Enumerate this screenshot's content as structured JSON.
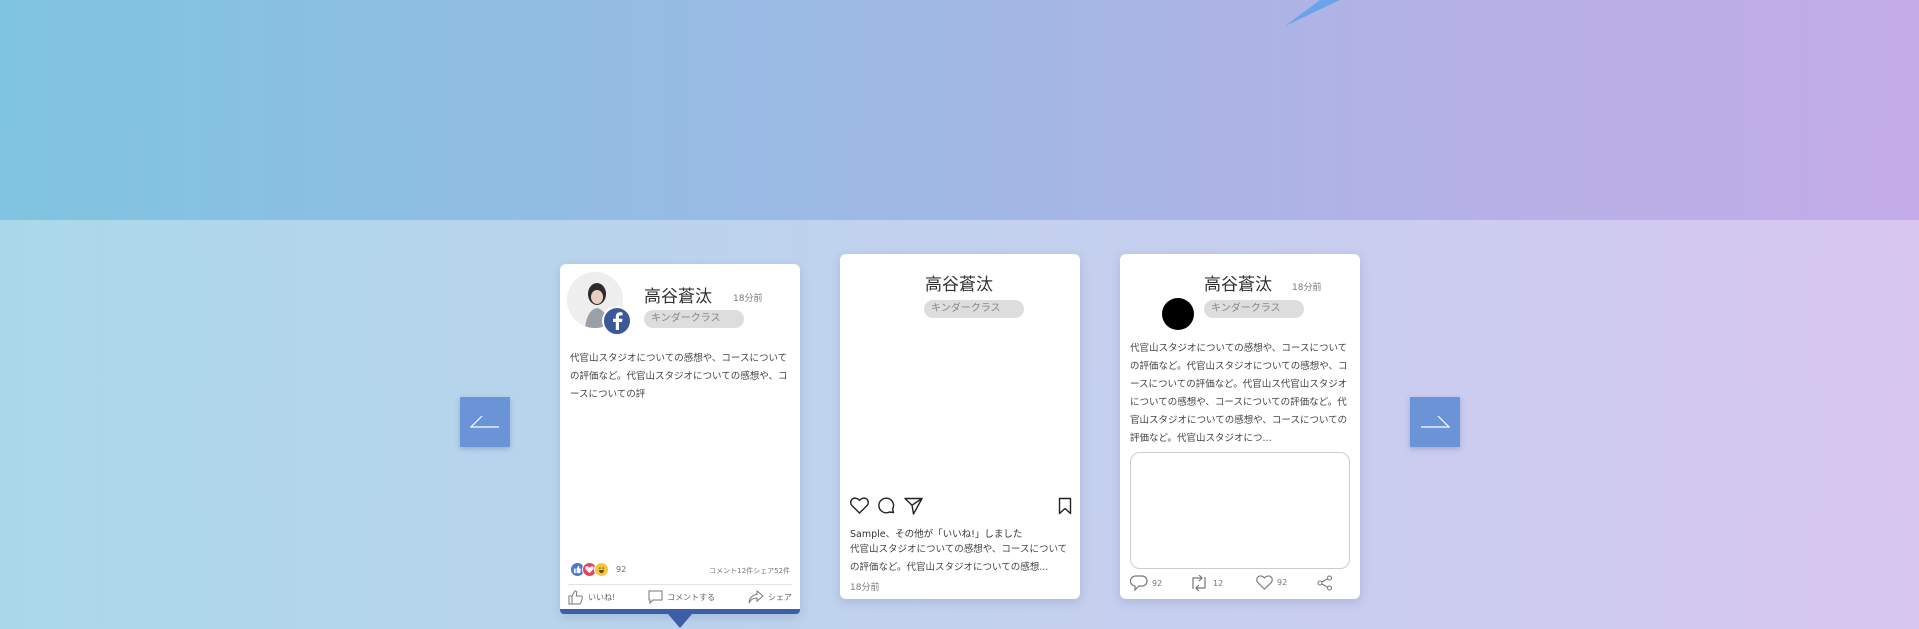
{
  "colors": {
    "facebook_blue": "#3b5998",
    "arrow_button": "#6b93d8",
    "bottom_bar": "#3b5ea8"
  },
  "carousel": {
    "prev_icon": "arrow-left-icon",
    "next_icon": "arrow-right-icon"
  },
  "facebook_card": {
    "name": "高谷蒼汰",
    "time": "18分前",
    "class_tag": "キンダークラス",
    "body": "代官山スタジオについての感想や、コースについての評価など。代官山スタジオについての感想や、コースについての評",
    "reaction_count": "92",
    "stats": "コメント12件シェア52件",
    "actions": {
      "like": "いいね!",
      "comment": "コメントする",
      "share": "シェア"
    }
  },
  "instagram_card": {
    "name": "高谷蒼汰",
    "class_tag": "キンダークラス",
    "liked_by": "Sample、その他が「いいね!」しました",
    "caption": "代官山スタジオについての感想や、コースについての評価など。代官山スタジオについての感想...",
    "time": "18分前"
  },
  "twitter_card": {
    "name": "高谷蒼汰",
    "time": "18分前",
    "class_tag": "キンダークラス",
    "body": "代官山スタジオについての感想や、コースについての評価など。代官山スタジオについての感想や、コースについての評価など。代官山ス代官山スタジオについての感想や、コースについての評価など。代官山スタジオについての感想や、コースについての評価など。代官山スタジオにつ...",
    "reply_count": "92",
    "retweet_count": "12",
    "like_count": "92"
  }
}
